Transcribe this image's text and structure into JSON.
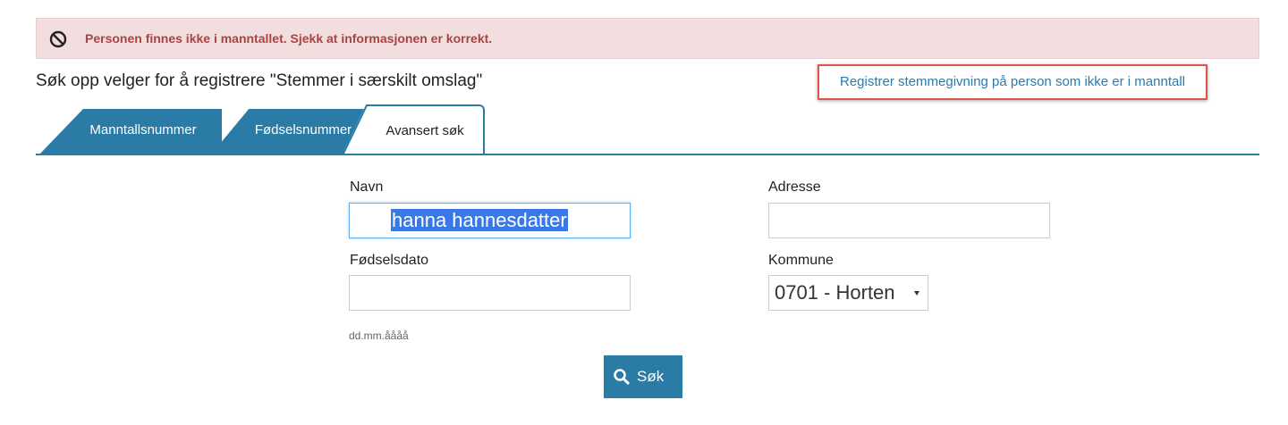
{
  "alert": {
    "icon": "prohibited-icon",
    "message": "Personen finnes ikke i manntallet. Sjekk at informasjonen er korrekt."
  },
  "title": "Søk opp velger for å registrere \"Stemmer i særskilt omslag\"",
  "register_link": "Registrer stemmegivning på person som ikke er i manntall",
  "tabs": [
    {
      "label": "Manntallsnummer",
      "active": false
    },
    {
      "label": "Fødselsnummer",
      "active": false
    },
    {
      "label": "Avansert søk",
      "active": true
    }
  ],
  "form": {
    "navn": {
      "label": "Navn",
      "value": "hanna hannesdatter"
    },
    "adresse": {
      "label": "Adresse",
      "value": ""
    },
    "fodselsdato": {
      "label": "Fødselsdato",
      "value": "",
      "hint": "dd.mm.åååå"
    },
    "kommune": {
      "label": "Kommune",
      "selected": "0701 - Horten"
    },
    "search_button": {
      "label": "Søk",
      "icon": "search-icon"
    }
  },
  "colors": {
    "accent": "#2a7ba6",
    "alert_bg": "#f2dede",
    "alert_text": "#a94442",
    "link": "#2a7ab0",
    "highlight_border": "#e0524c"
  }
}
